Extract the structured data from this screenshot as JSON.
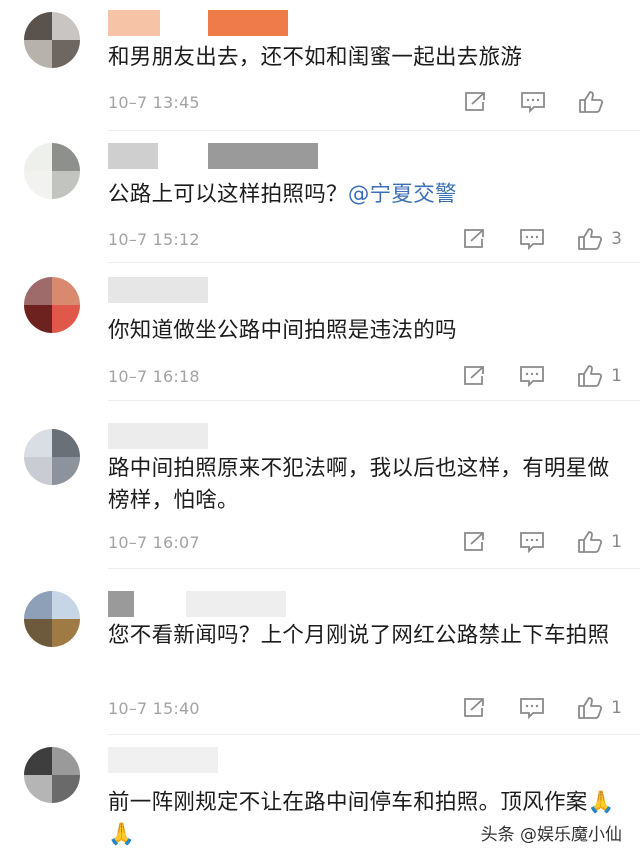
{
  "comments": [
    {
      "text": "和男朋友出去，还不如和闺蜜一起出去旅游",
      "time": "10–7 13:45",
      "likes": ""
    },
    {
      "text": "公路上可以这样拍照吗？",
      "mention": "@宁夏交警",
      "time": "10–7 15:12",
      "likes": "3"
    },
    {
      "text": "你知道做坐公路中间拍照是违法的吗",
      "time": "10–7 16:18",
      "likes": "1"
    },
    {
      "text": "路中间拍照原来不犯法啊，我以后也这样，有明星做榜样，怕啥。",
      "time": "10–7 16:07",
      "likes": "1"
    },
    {
      "text": "您不看新闻吗？上个月刚说了网红公路禁止下车拍照",
      "time": "10–7 15:40",
      "likes": "1"
    },
    {
      "text": "前一阵刚规定不让在路中间停车和拍照。顶风作案",
      "emoji": "🙏🙏",
      "time": "",
      "likes": ""
    }
  ],
  "icons": [
    "share-icon",
    "comment-icon",
    "like-icon",
    "pray-hands-emoji"
  ],
  "watermark": "头条 @娱乐魔小仙",
  "colors": {
    "mention": "#3b6fb6",
    "time": "#a3a3a3",
    "icon": "#8a8a8a"
  }
}
